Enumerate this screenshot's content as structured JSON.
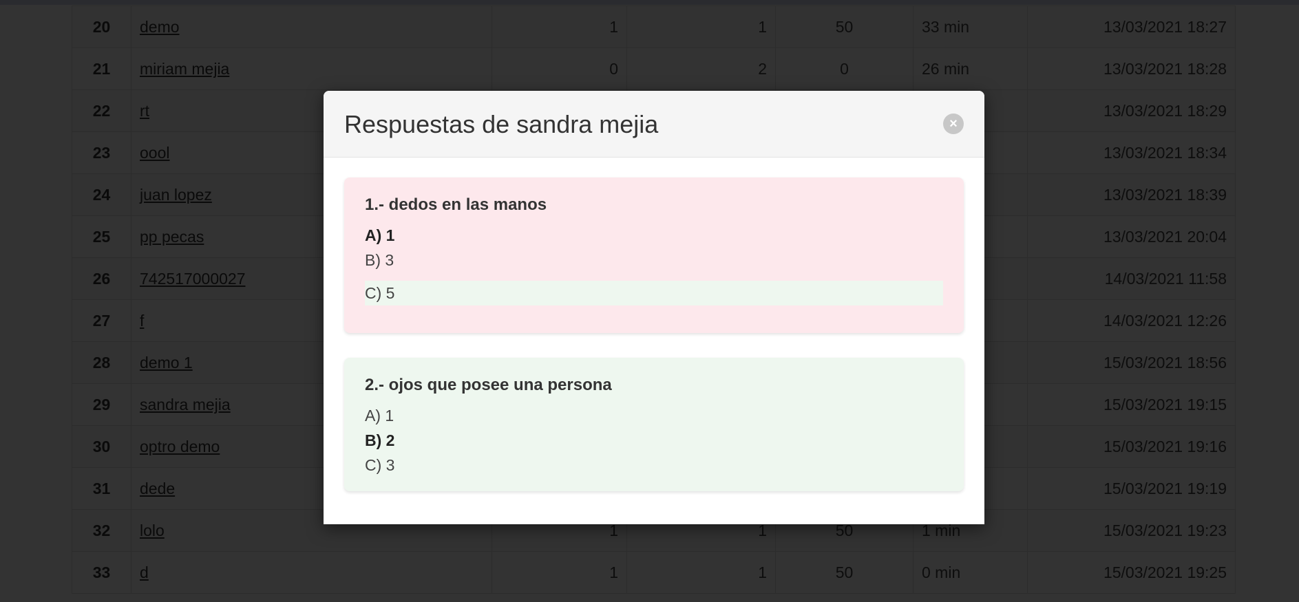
{
  "table": {
    "rows": [
      {
        "num": "20",
        "name": "demo",
        "c1": "1",
        "c2": "1",
        "c3": "50",
        "time": "33 min",
        "date": "13/03/2021 18:27"
      },
      {
        "num": "21",
        "name": "miriam mejia",
        "c1": "0",
        "c2": "2",
        "c3": "0",
        "time": "26 min",
        "date": "13/03/2021 18:28"
      },
      {
        "num": "22",
        "name": "rt",
        "c1": "",
        "c2": "",
        "c3": "",
        "time": "",
        "date": "13/03/2021 18:29"
      },
      {
        "num": "23",
        "name": "oool",
        "c1": "",
        "c2": "",
        "c3": "",
        "time": "",
        "date": "13/03/2021 18:34"
      },
      {
        "num": "24",
        "name": "juan lopez",
        "c1": "",
        "c2": "",
        "c3": "",
        "time": "",
        "date": "13/03/2021 18:39"
      },
      {
        "num": "25",
        "name": "pp pecas",
        "c1": "",
        "c2": "",
        "c3": "",
        "time": "",
        "date": "13/03/2021 20:04"
      },
      {
        "num": "26",
        "name": "742517000027",
        "c1": "",
        "c2": "",
        "c3": "",
        "time": "",
        "date": "14/03/2021 11:58"
      },
      {
        "num": "27",
        "name": "f",
        "c1": "",
        "c2": "",
        "c3": "",
        "time": "",
        "date": "14/03/2021 12:26"
      },
      {
        "num": "28",
        "name": "demo 1",
        "c1": "",
        "c2": "",
        "c3": "",
        "time": "",
        "date": "15/03/2021 18:56"
      },
      {
        "num": "29",
        "name": "sandra mejia",
        "c1": "",
        "c2": "",
        "c3": "",
        "time": "",
        "date": "15/03/2021 19:15"
      },
      {
        "num": "30",
        "name": "optro demo",
        "c1": "",
        "c2": "",
        "c3": "",
        "time": "",
        "date": "15/03/2021 19:16"
      },
      {
        "num": "31",
        "name": "dede",
        "c1": "",
        "c2": "",
        "c3": "",
        "time": "",
        "date": "15/03/2021 19:19"
      },
      {
        "num": "32",
        "name": "lolo",
        "c1": "1",
        "c2": "1",
        "c3": "50",
        "time": "1 min",
        "date": "15/03/2021 19:23"
      },
      {
        "num": "33",
        "name": "d",
        "c1": "1",
        "c2": "1",
        "c3": "50",
        "time": "0 min",
        "date": "15/03/2021 19:25"
      }
    ]
  },
  "modal": {
    "title": "Respuestas de sandra mejia",
    "close_icon": "×",
    "questions": [
      {
        "text": "1.- dedos en las manos",
        "status": "incorrect",
        "options": [
          "A) 1",
          "B) 3",
          "C) 5"
        ]
      },
      {
        "text": "2.- ojos que posee una persona",
        "status": "correct",
        "options": [
          "A) 1",
          "B) 2",
          "C) 3"
        ]
      }
    ]
  },
  "colors": {
    "incorrect_bg": "#fde8ec",
    "correct_bg": "#eef7ef"
  }
}
